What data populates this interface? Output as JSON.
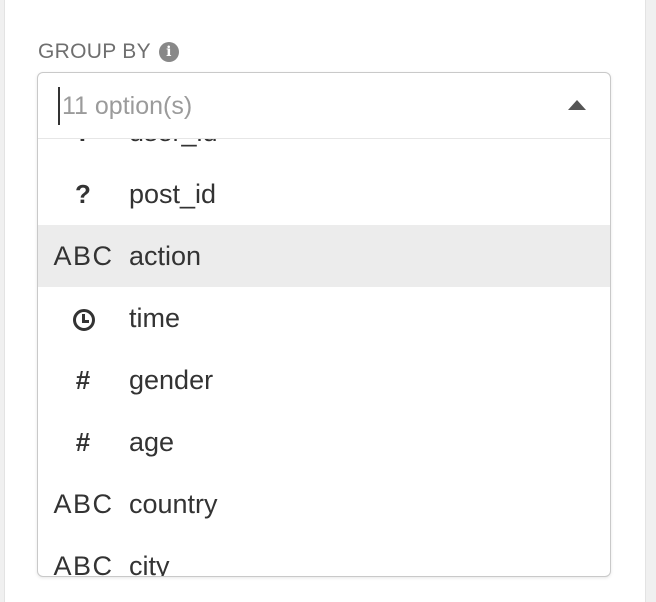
{
  "field": {
    "label": "GROUP BY",
    "info_icon": "info-circle-icon"
  },
  "search": {
    "placeholder": "11 option(s)",
    "value": ""
  },
  "dropdown": {
    "expanded": true,
    "caret_icon": "caret-up-icon",
    "options": [
      {
        "type_label": "?",
        "type_icon": "unknown-type-icon",
        "name": "user_id"
      },
      {
        "type_label": "?",
        "type_icon": "unknown-type-icon",
        "name": "post_id"
      },
      {
        "type_label": "ABC",
        "type_icon": "string-type-icon",
        "name": "action",
        "highlighted": true
      },
      {
        "type_label": "",
        "type_icon": "clock-icon",
        "name": "time"
      },
      {
        "type_label": "#",
        "type_icon": "numeric-type-icon",
        "name": "gender"
      },
      {
        "type_label": "#",
        "type_icon": "numeric-type-icon",
        "name": "age"
      },
      {
        "type_label": "ABC",
        "type_icon": "string-type-icon",
        "name": "country"
      },
      {
        "type_label": "ABC",
        "type_icon": "string-type-icon",
        "name": "city"
      }
    ]
  },
  "colors": {
    "highlight": "#ececec",
    "text": "#333333",
    "label": "#6f6f6f",
    "border": "#c9c9c9"
  }
}
